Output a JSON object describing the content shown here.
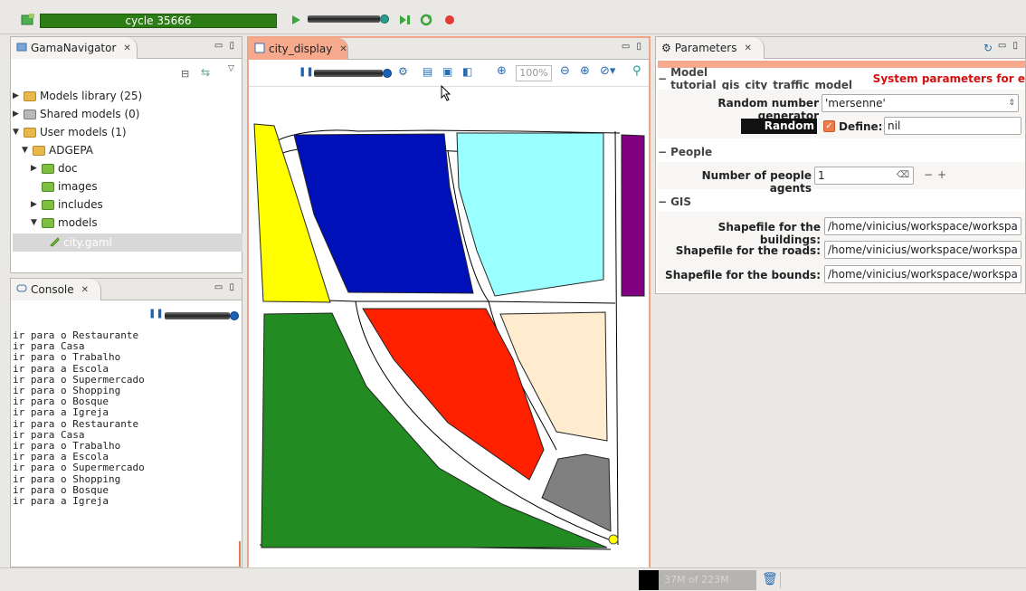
{
  "toolbar": {
    "cycle_label": "cycle 35666",
    "icons": [
      "run-experiment-icon",
      "play-icon",
      "step-icon",
      "reload-icon",
      "stop-icon"
    ]
  },
  "navigator": {
    "tab_label": "GamaNavigator",
    "items": [
      {
        "label": "Models library (25)",
        "expanded": false
      },
      {
        "label": "Shared models (0)",
        "expanded": false
      },
      {
        "label": "User models (1)",
        "expanded": true
      },
      {
        "label": "ADGEPA",
        "expanded": true
      },
      {
        "label": "doc",
        "expanded": false
      },
      {
        "label": "images",
        "expanded": false
      },
      {
        "label": "includes",
        "expanded": false
      },
      {
        "label": "models",
        "expanded": true
      },
      {
        "label": "city.gaml",
        "selected": true
      }
    ]
  },
  "console": {
    "tab_label": "Console",
    "lines": [
      "ir para o Restaurante",
      "ir para Casa",
      "ir para o Trabalho",
      "ir para a Escola",
      "ir para o Supermercado",
      "ir para o Shopping",
      "ir para o Bosque",
      "ir para a Igreja",
      "ir para o Restaurante",
      "ir para Casa",
      "ir para o Trabalho",
      "ir para a Escola",
      "ir para o Supermercado",
      "ir para o Shopping",
      "ir para o Bosque",
      "ir para a Igreja"
    ]
  },
  "display": {
    "tab_label": "city_display",
    "zoom": "100%",
    "colors": {
      "yellow": "#ffff00",
      "blue": "#0010b8",
      "cyan": "#99ffff",
      "purple": "#800080",
      "green": "#228b22",
      "red": "#ff2000",
      "beige": "#ffebcd",
      "grey": "#808080"
    }
  },
  "params": {
    "tab_label": "Parameters",
    "model_prefix": "Model tutorial_gis_city_traffic_model",
    "system_label": "System parameters for e",
    "rng_label": "Random number generator",
    "rng_value": "'mersenne'",
    "seed_label": "Random seed",
    "define_label": "Define:",
    "define_checked": true,
    "seed_value": "nil",
    "people_section": "People",
    "people_label": "Number of people agents",
    "people_value": "1",
    "gis_section": "GIS",
    "buildings_label": "Shapefile for the buildings:",
    "buildings_value": "/home/vinicius/workspace/workspa",
    "roads_label": "Shapefile for the roads:",
    "roads_value": "/home/vinicius/workspace/workspa",
    "bounds_label": "Shapefile for the bounds:",
    "bounds_value": "/home/vinicius/workspace/workspa"
  },
  "status": {
    "memory": "37M of 223M",
    "memory_fraction": 0.17
  }
}
